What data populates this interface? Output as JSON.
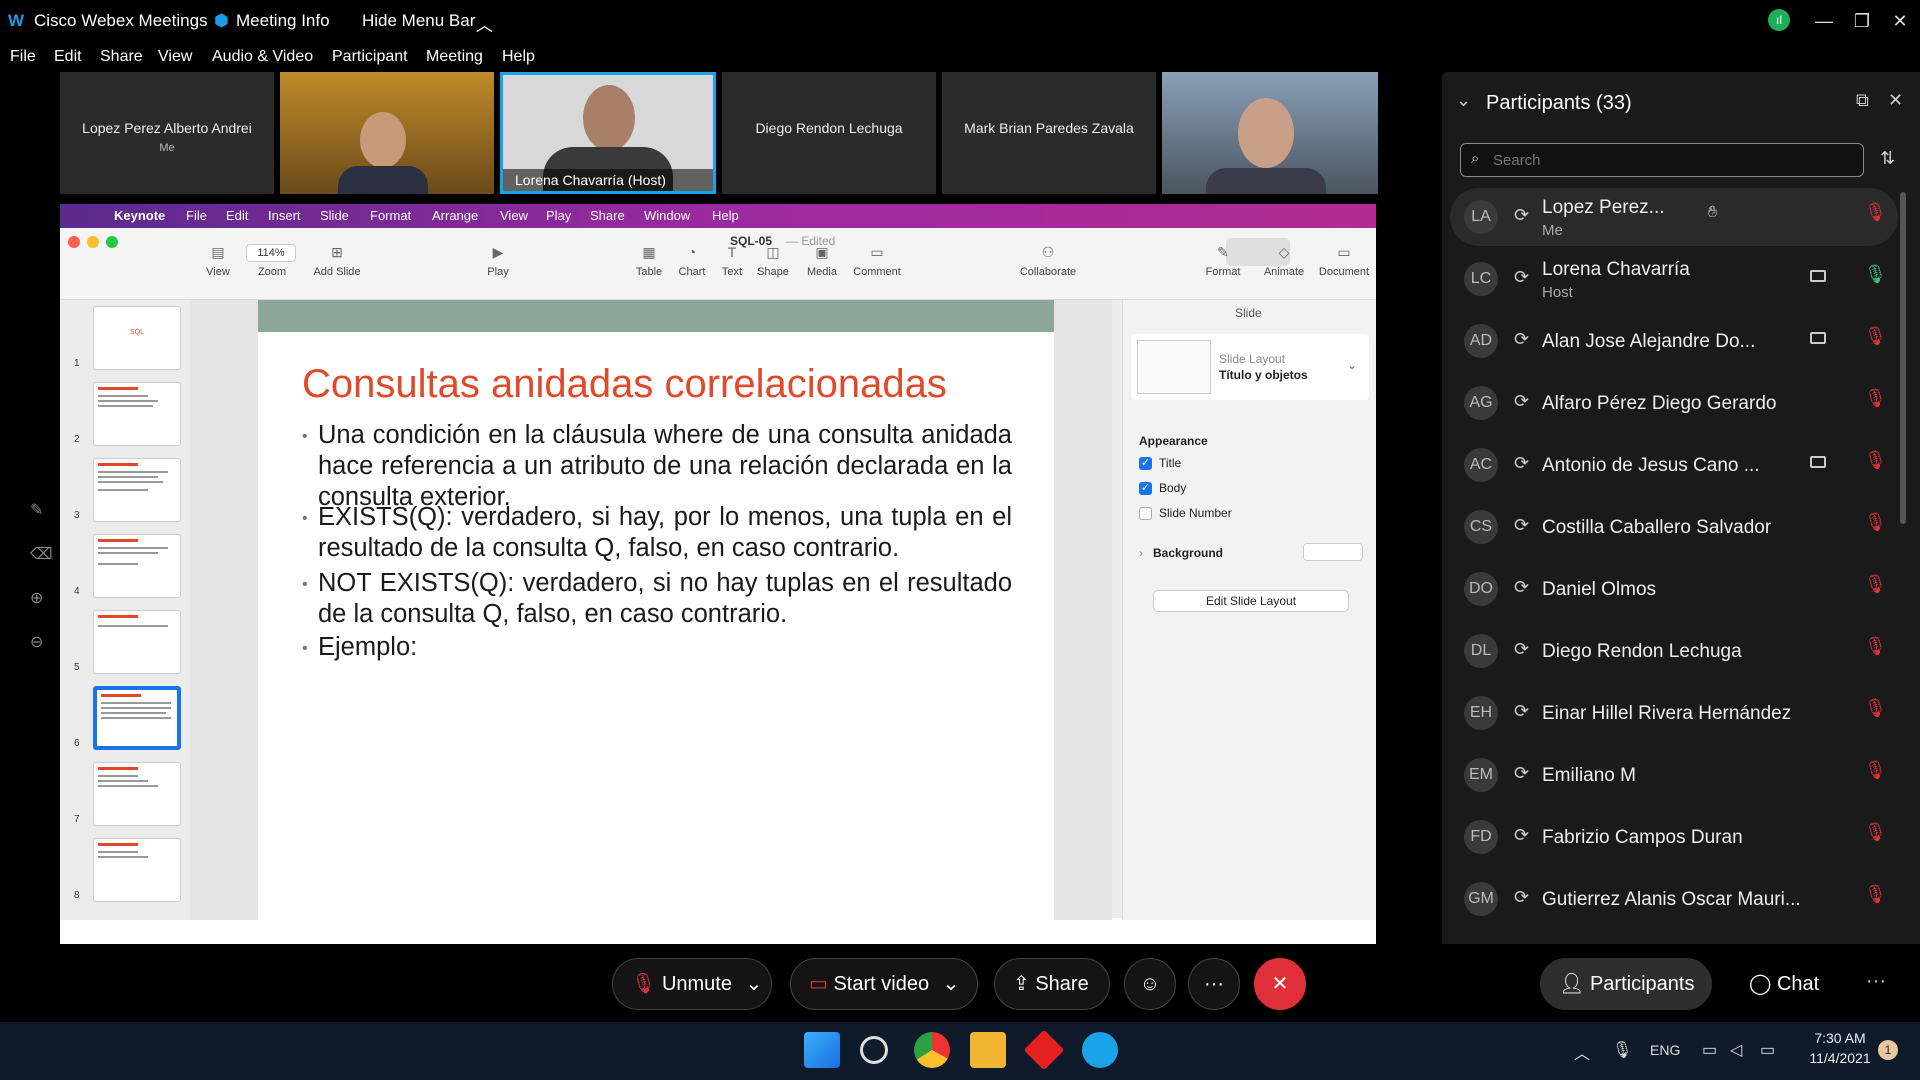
{
  "titlebar": {
    "app_name": "Cisco Webex Meetings",
    "meeting_info": "Meeting Info",
    "hide_menu": "Hide Menu Bar"
  },
  "menu": [
    "File",
    "Edit",
    "Share",
    "View",
    "Audio & Video",
    "Participant",
    "Meeting",
    "Help"
  ],
  "video_strip": [
    {
      "name": "Lopez Perez Alberto Andrei",
      "sub": "Me",
      "type": "name"
    },
    {
      "name": "",
      "type": "camera"
    },
    {
      "name": "Lorena Chavarría  (Host)",
      "type": "camera-active"
    },
    {
      "name": "Diego Rendon Lechuga",
      "type": "name"
    },
    {
      "name": "Mark Brian Paredes Zavala",
      "type": "name"
    },
    {
      "name": "",
      "type": "camera"
    }
  ],
  "keynote": {
    "mac_menu": [
      "Keynote",
      "File",
      "Edit",
      "Insert",
      "Slide",
      "Format",
      "Arrange",
      "View",
      "Play",
      "Share",
      "Window",
      "Help"
    ],
    "doc_title": "SQL-05",
    "doc_status": "— Edited",
    "zoom": "114%",
    "toolbar": [
      "View",
      "Zoom",
      "Add Slide",
      "Play",
      "Table",
      "Chart",
      "Text",
      "Shape",
      "Media",
      "Comment",
      "Collaborate",
      "Format",
      "Animate",
      "Document"
    ],
    "slide_numbers": [
      "1",
      "2",
      "3",
      "4",
      "5",
      "6",
      "7",
      "8"
    ],
    "thumb1_text": "SQL",
    "selected_slide": 6
  },
  "slide": {
    "title": "Consultas anidadas correlacionadas",
    "bullets": [
      "Una condición en la cláusula where de una consulta anidada hace referencia a un atributo de una relación declarada en la consulta exterior.",
      "EXISTS(Q): verdadero, si hay, por lo menos, una tupla en el resultado de la consulta Q, falso, en caso contrario.",
      "NOT EXISTS(Q): verdadero, si no hay tuplas en el resultado de la consulta Q, falso, en caso contrario.",
      "Ejemplo:"
    ]
  },
  "inspector": {
    "tab": "Slide",
    "layout_label": "Slide Layout",
    "layout_value": "Título y objetos",
    "appearance": "Appearance",
    "checks": [
      {
        "label": "Title",
        "checked": true
      },
      {
        "label": "Body",
        "checked": true
      },
      {
        "label": "Slide Number",
        "checked": false
      }
    ],
    "background": "Background",
    "edit_layout": "Edit Slide Layout"
  },
  "participants": {
    "header": "Participants (33)",
    "search_placeholder": "Search",
    "list": [
      {
        "initials": "LA",
        "name": "Lopez Perez...",
        "role": "Me",
        "video": false,
        "mic": "muted"
      },
      {
        "initials": "LC",
        "name": "Lorena Chavarría",
        "role": "Host",
        "video": true,
        "mic": "on"
      },
      {
        "initials": "AD",
        "name": "Alan Jose Alejandre Do...",
        "role": "",
        "video": true,
        "mic": "muted"
      },
      {
        "initials": "AG",
        "name": "Alfaro Pérez Diego Gerardo",
        "role": "",
        "video": false,
        "mic": "muted"
      },
      {
        "initials": "AC",
        "name": "Antonio de Jesus Cano ...",
        "role": "",
        "video": true,
        "mic": "muted"
      },
      {
        "initials": "CS",
        "name": "Costilla Caballero Salvador",
        "role": "",
        "video": false,
        "mic": "muted"
      },
      {
        "initials": "DO",
        "name": "Daniel Olmos",
        "role": "",
        "video": false,
        "mic": "muted"
      },
      {
        "initials": "DL",
        "name": "Diego Rendon Lechuga",
        "role": "",
        "video": false,
        "mic": "muted"
      },
      {
        "initials": "EH",
        "name": "Einar Hillel Rivera Hernández",
        "role": "",
        "video": false,
        "mic": "muted"
      },
      {
        "initials": "EM",
        "name": "Emiliano M",
        "role": "",
        "video": false,
        "mic": "muted"
      },
      {
        "initials": "FD",
        "name": "Fabrizio Campos Duran",
        "role": "",
        "video": false,
        "mic": "muted"
      },
      {
        "initials": "GM",
        "name": "Gutierrez Alanis Oscar Mauri...",
        "role": "",
        "video": false,
        "mic": "muted"
      }
    ]
  },
  "controls": {
    "unmute": "Unmute",
    "start_video": "Start video",
    "share": "Share",
    "participants": "Participants",
    "chat": "Chat"
  },
  "taskbar": {
    "lang": "ENG",
    "time": "7:30 AM",
    "date": "11/4/2021",
    "notifications": "1"
  },
  "colors": {
    "end_call": "#e0313b",
    "active_speaker": "#1aa3e8",
    "slide_title": "#e04a2a"
  }
}
